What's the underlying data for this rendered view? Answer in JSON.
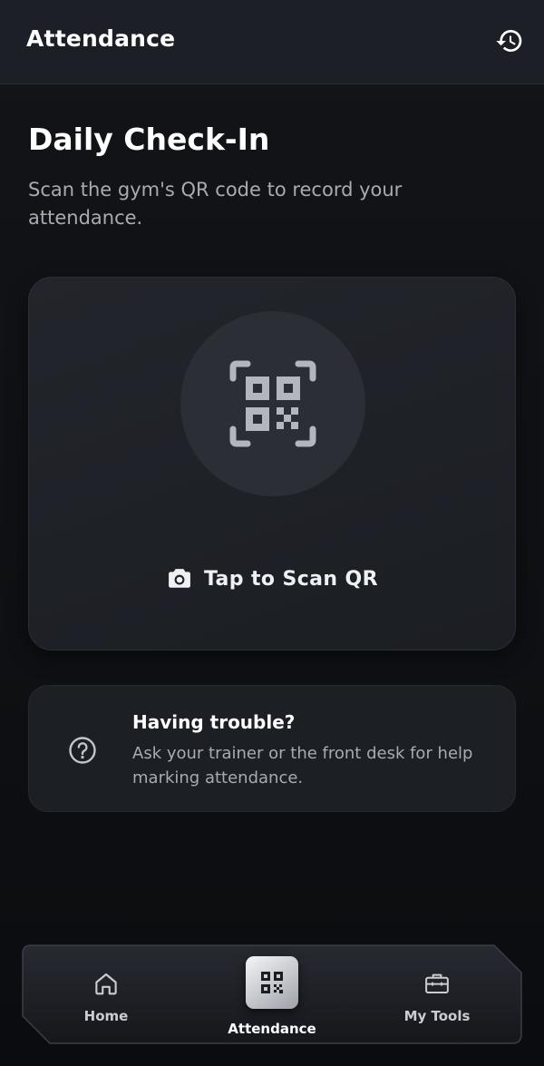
{
  "header": {
    "title": "Attendance",
    "history_icon": "history-icon"
  },
  "main": {
    "title": "Daily Check-In",
    "subtitle": "Scan the gym's QR code to record your attendance."
  },
  "scan_card": {
    "qr_icon": "qr-code-icon",
    "camera_icon": "camera-icon",
    "label": "Tap to Scan QR"
  },
  "help_card": {
    "icon": "help-circle-icon",
    "title": "Having trouble?",
    "text": "Ask your trainer or the front desk for help marking attendance."
  },
  "bottom_nav": {
    "items": [
      {
        "label": "Home",
        "icon": "home-icon",
        "active": false
      },
      {
        "label": "Attendance",
        "icon": "qr-code-icon",
        "active": true
      },
      {
        "label": "My Tools",
        "icon": "toolbox-icon",
        "active": false
      }
    ]
  },
  "colors": {
    "background": "#0e1013",
    "header": "#1c1f25",
    "card": "#1e2126",
    "muted_text": "#a7abb3",
    "active_tile": "#d9dbdf"
  }
}
